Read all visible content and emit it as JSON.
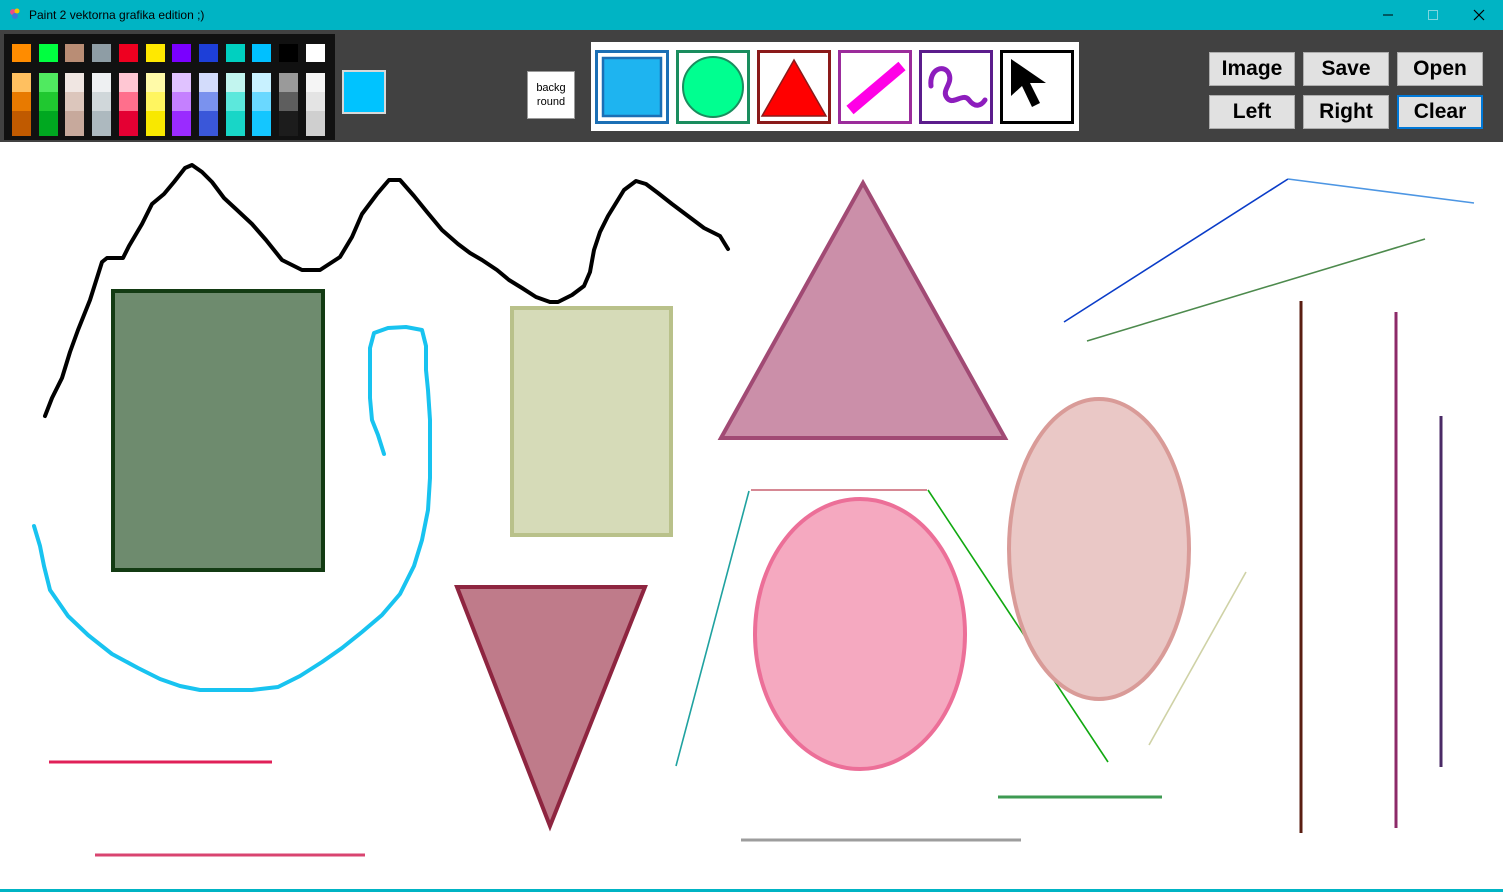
{
  "window": {
    "title": "Paint 2 vektorna grafika edition ;)",
    "controls": [
      "minimize",
      "maximize",
      "close"
    ]
  },
  "palette": {
    "colors": [
      [
        "#ff8c00",
        "#ffc060",
        "#e87a00",
        "#c05a00"
      ],
      [
        "#00ff40",
        "#50ea60",
        "#20c830",
        "#00a820"
      ],
      [
        "#b98d75",
        "#f0e6e2",
        "#dcc6bc",
        "#c7a99c"
      ],
      [
        "#8e9da5",
        "#eef0f2",
        "#d0d7da",
        "#adb9bf"
      ],
      [
        "#ee0020",
        "#ffc7d3",
        "#ff6f8c",
        "#e40033"
      ],
      [
        "#ffe800",
        "#fffaa8",
        "#fff560",
        "#f8e800"
      ],
      [
        "#7a00ff",
        "#e0c2ff",
        "#c580ff",
        "#9a2bff"
      ],
      [
        "#1d3fd8",
        "#d3dcfb",
        "#7a92ee",
        "#3a57d9"
      ],
      [
        "#00d0c0",
        "#c2f5ef",
        "#5ce8dc",
        "#18d6c7"
      ],
      [
        "#00c0ff",
        "#c8f1ff",
        "#6ad8ff",
        "#14c6ff"
      ],
      [
        "#000000",
        "#9a9a9a",
        "#5e5e5e",
        "#1c1c1c"
      ],
      [
        "#ffffff",
        "#f5f5f5",
        "#e4e4e4",
        "#cfcfcf"
      ]
    ],
    "current_color": "#00c3ff"
  },
  "background_button": {
    "label": "backg\nround"
  },
  "tools": [
    {
      "name": "rectangle-tool",
      "icon": "blue-square-icon",
      "border": "#1b6fb5"
    },
    {
      "name": "ellipse-tool",
      "icon": "green-circle-icon",
      "border": "#1a8d5e"
    },
    {
      "name": "triangle-tool",
      "icon": "red-triangle-icon",
      "border": "#8b1a1a"
    },
    {
      "name": "line-tool",
      "icon": "magenta-line-icon",
      "border": "#9b2c9b"
    },
    {
      "name": "freehand-tool",
      "icon": "purple-squiggle-icon",
      "border": "#5b1c8c"
    },
    {
      "name": "select-tool",
      "icon": "cursor-arrow-icon",
      "border": "#000000"
    }
  ],
  "actions": {
    "image": "Image",
    "save": "Save",
    "open": "Open",
    "left": "Left",
    "right": "Right",
    "clear": "Clear"
  },
  "canvas_shapes": [
    {
      "kind": "freehand",
      "color": "#000000"
    },
    {
      "kind": "freehand",
      "color": "#18c3f0"
    },
    {
      "kind": "rectangle",
      "fill": "#6e8b6e",
      "stroke": "#133b13"
    },
    {
      "kind": "rectangle",
      "fill": "#d6dbb8",
      "stroke": "#b9c18a"
    },
    {
      "kind": "triangle",
      "fill": "#cb8fa9",
      "stroke": "#a14a74"
    },
    {
      "kind": "triangle",
      "fill": "#bf7b8a",
      "stroke": "#8e2540"
    },
    {
      "kind": "ellipse",
      "fill": "#f5a9c0",
      "stroke": "#ec6f98"
    },
    {
      "kind": "ellipse",
      "fill": "#eac8c6",
      "stroke": "#d99b98"
    },
    {
      "kind": "lines",
      "colors": [
        "#0a3cc8",
        "#4d96e3",
        "#4d8a4d",
        "#5a1e12",
        "#8c2a68",
        "#4a2a66",
        "#1fa2a0",
        "#c96070",
        "#11a811",
        "#cfd2a6",
        "#e02058",
        "#d94470",
        "#3e9a52",
        "#9d9d9d"
      ]
    }
  ]
}
